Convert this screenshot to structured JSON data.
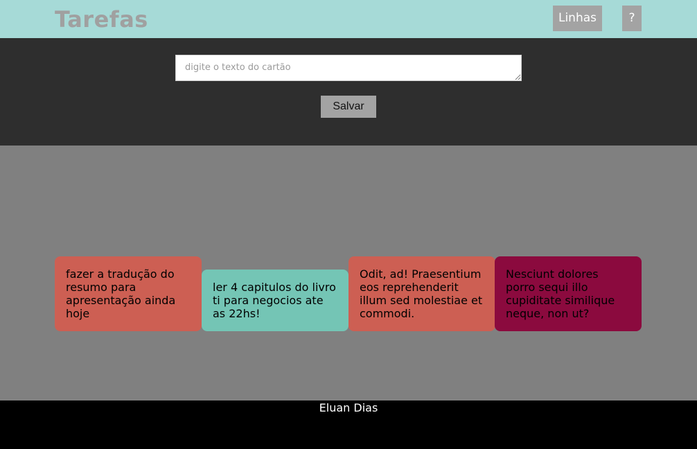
{
  "header": {
    "title": "Tarefas",
    "lines_button_label": "Linhas",
    "help_button_label": "?"
  },
  "composer": {
    "placeholder": "digite o texto do cartão",
    "value": "",
    "save_label": "Salvar"
  },
  "cards": [
    {
      "text": "fazer a tradução do resumo para apresentação ainda hoje",
      "color": "#cd5f53"
    },
    {
      "text": "ler 4 capitulos do livro ti para negocios ate as 22hs!",
      "color": "#74c5b5"
    },
    {
      "text": "Odit, ad! Praesentium eos reprehenderit illum sed molestiae et commodi.",
      "color": "#cd5f53"
    },
    {
      "text": "Nesciunt dolores porro sequi illo cupiditate similique neque, non ut?",
      "color": "#8b0a3e"
    }
  ],
  "footer": {
    "author": "Eluan Dias"
  },
  "colors": {
    "header_bg": "#a6dad7",
    "composer_bg": "#2e2e2e",
    "board_bg": "#808080",
    "footer_bg": "#000000",
    "button_bg": "#a3a3a3"
  }
}
